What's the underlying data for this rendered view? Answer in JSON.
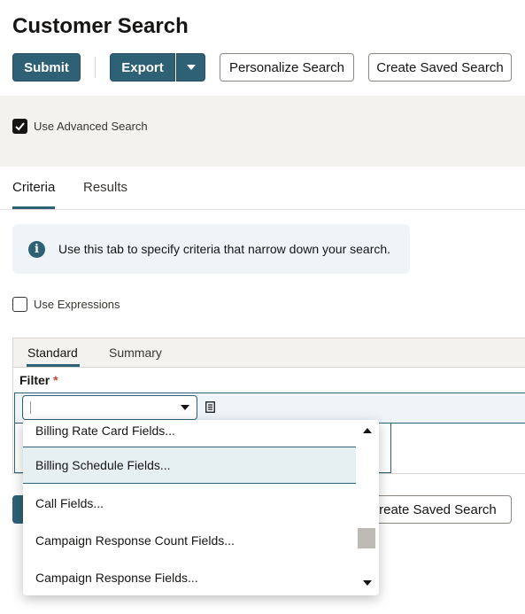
{
  "page": {
    "title": "Customer Search"
  },
  "toolbar": {
    "submit_label": "Submit",
    "export_label": "Export",
    "personalize_label": "Personalize Search",
    "create_saved_label": "Create Saved Search"
  },
  "options": {
    "advanced_search_label": "Use Advanced Search",
    "advanced_search_checked": true,
    "use_expressions_label": "Use Expressions",
    "use_expressions_checked": false
  },
  "tabs": [
    {
      "label": "Criteria",
      "active": true
    },
    {
      "label": "Results",
      "active": false
    }
  ],
  "info": {
    "message": "Use this tab to specify criteria that narrow down your search."
  },
  "subtabs": [
    {
      "label": "Standard",
      "active": true
    },
    {
      "label": "Summary",
      "active": false
    }
  ],
  "filter": {
    "label": "Filter",
    "required_mark": "*",
    "value": ""
  },
  "dropdown": {
    "items": [
      "Billing Rate Card Fields...",
      "Billing Schedule Fields...",
      "Call Fields...",
      "Campaign Response Count Fields...",
      "Campaign Response Fields..."
    ],
    "highlighted_index": 1
  },
  "footer": {
    "create_saved_label": "Create Saved Search"
  },
  "colors": {
    "primary": "#2f6176",
    "required": "#c74634",
    "band": "#f4f2ef",
    "info_bg": "#eef4f8"
  }
}
